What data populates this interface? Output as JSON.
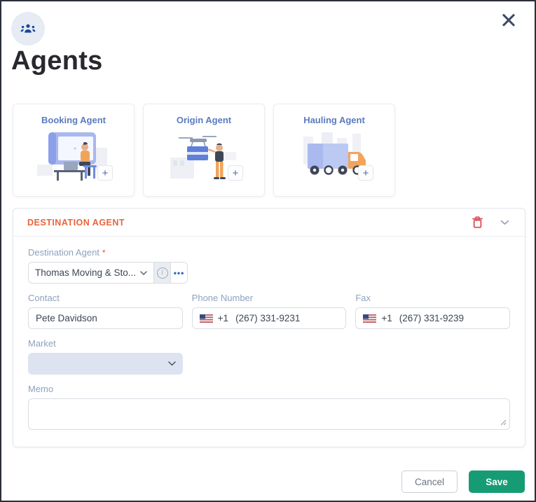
{
  "header": {
    "title": "Agents"
  },
  "icons": {
    "close": "✕",
    "plus": "+",
    "ellipsis": "•••",
    "info": "i",
    "agents_badge": "users-group-icon",
    "delete": "trash-icon",
    "collapse": "chevron-down-icon"
  },
  "agent_cards": [
    {
      "label": "Booking Agent"
    },
    {
      "label": "Origin Agent"
    },
    {
      "label": "Hauling Agent"
    }
  ],
  "destination_section": {
    "title": "DESTINATION AGENT",
    "fields": {
      "destination_agent": {
        "label": "Destination Agent",
        "required_mark": "*",
        "value": "Thomas Moving & Sto..."
      },
      "contact": {
        "label": "Contact",
        "value": "Pete Davidson"
      },
      "phone": {
        "label": "Phone Number",
        "dial_code": "+1",
        "value": "(267) 331-9231"
      },
      "fax": {
        "label": "Fax",
        "dial_code": "+1",
        "value": "(267) 331-9239"
      },
      "market": {
        "label": "Market",
        "value": ""
      },
      "memo": {
        "label": "Memo",
        "value": ""
      }
    }
  },
  "footer": {
    "cancel_label": "Cancel",
    "save_label": "Save"
  },
  "colors": {
    "accent_orange": "#e8653a",
    "danger_red": "#d9434e",
    "primary_blue": "#2d66c3",
    "card_title_blue": "#5b7ac1",
    "save_green": "#169c74",
    "badge_icon_navy": "#17479e"
  }
}
